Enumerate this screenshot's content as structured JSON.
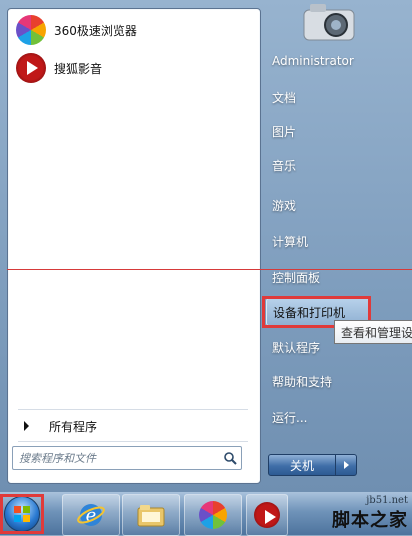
{
  "pinned_apps": [
    {
      "label": "360极速浏览器",
      "icon": "360-browser-icon"
    },
    {
      "label": "搜狐影音",
      "icon": "sohu-video-icon"
    }
  ],
  "all_programs_label": "所有程序",
  "search": {
    "placeholder": "搜索程序和文件"
  },
  "right_menu": {
    "user": "Administrator",
    "items": [
      "文档",
      "图片",
      "音乐",
      "游戏",
      "计算机",
      "控制面板",
      "设备和打印机",
      "默认程序",
      "帮助和支持",
      "运行..."
    ]
  },
  "tooltip": "查看和管理设",
  "shutdown": {
    "label": "关机"
  },
  "watermark": {
    "url": "jb51.net",
    "name": "脚本之家"
  },
  "colors": {
    "highlight_border": "#e03a3a",
    "shutdown_button": "#3f6ea8"
  }
}
